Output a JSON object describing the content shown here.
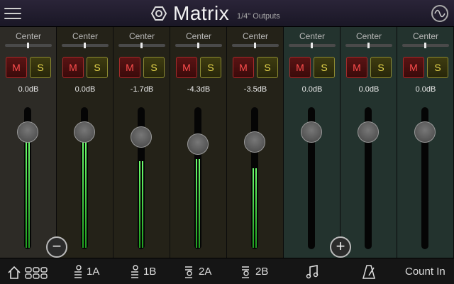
{
  "header": {
    "title": "Matrix",
    "subtitle": "1/4\" Outputs"
  },
  "channels": [
    {
      "pan": "Center",
      "mute": "M",
      "solo": "S",
      "gain": "0.0dB",
      "tab_label": "",
      "tab_icon": "home-icon",
      "meter_level": 0.77
    },
    {
      "pan": "Center",
      "mute": "M",
      "solo": "S",
      "gain": "0.0dB",
      "tab_label": "1A",
      "tab_icon": "input-1-icon",
      "meter_level": 0.77
    },
    {
      "pan": "Center",
      "mute": "M",
      "solo": "S",
      "gain": "-1.7dB",
      "tab_label": "1B",
      "tab_icon": "input-1-icon",
      "meter_level": 0.62
    },
    {
      "pan": "Center",
      "mute": "M",
      "solo": "S",
      "gain": "-4.3dB",
      "tab_label": "2A",
      "tab_icon": "input-2-icon",
      "meter_level": 0.64
    },
    {
      "pan": "Center",
      "mute": "M",
      "solo": "S",
      "gain": "-3.5dB",
      "tab_label": "2B",
      "tab_icon": "input-2-icon",
      "meter_level": 0.57
    },
    {
      "pan": "Center",
      "mute": "M",
      "solo": "S",
      "gain": "0.0dB",
      "tab_label": "",
      "tab_icon": "music-note-icon",
      "meter_level": 0
    },
    {
      "pan": "Center",
      "mute": "M",
      "solo": "S",
      "gain": "0.0dB",
      "tab_label": "",
      "tab_icon": "metronome-icon",
      "meter_level": 0
    },
    {
      "pan": "Center",
      "mute": "M",
      "solo": "S",
      "gain": "0.0dB",
      "tab_label": "Count In",
      "tab_icon": "",
      "meter_level": 0
    }
  ],
  "controls": {
    "remove_symbol": "−",
    "add_symbol": "+"
  },
  "colors": {
    "strip_dark": "#2b2a25",
    "strip_olive": "#25231a",
    "strip_teal": "#22302c",
    "meter_green": "#3cdc3c"
  }
}
